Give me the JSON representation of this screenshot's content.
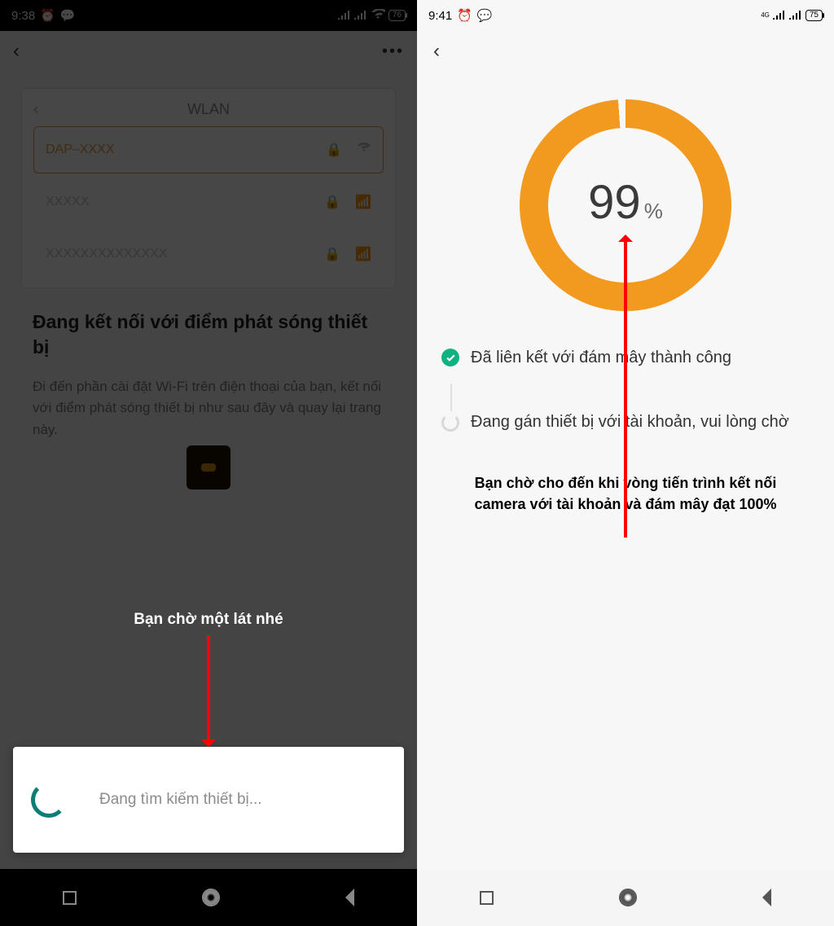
{
  "left": {
    "statusbar": {
      "time": "9:38",
      "battery": "76"
    },
    "wlan_title": "WLAN",
    "networks": [
      {
        "ssid": "DAP–XXXX",
        "highlight": true
      },
      {
        "ssid": "XXXXX",
        "highlight": false
      },
      {
        "ssid": "XXXXXXXXXXXXXX",
        "highlight": false
      }
    ],
    "panel_title": "Đang kết nối với điểm phát sóng thiết bị",
    "panel_sub": "Đi đến phần cài đặt Wi-Fi trên điện thoại của bạn, kết nối với điểm phát sóng thiết bị như sau đây và quay lại trang này.",
    "searching_text": "Đang tìm kiếm thiết bị...",
    "annotation": "Bạn chờ một lát nhé"
  },
  "right": {
    "statusbar": {
      "time": "9:41",
      "battery": "75",
      "net": "4G"
    },
    "progress": {
      "value": "99",
      "symbol": "%"
    },
    "status_connected": "Đã liên kết với đám mây thành công",
    "status_assigning": "Đang gán thiết bị với tài khoản, vui lòng chờ",
    "annotation": "Bạn chờ cho đến khi vòng tiến trình kết nối camera với tài khoản và đám mây đạt 100%"
  }
}
